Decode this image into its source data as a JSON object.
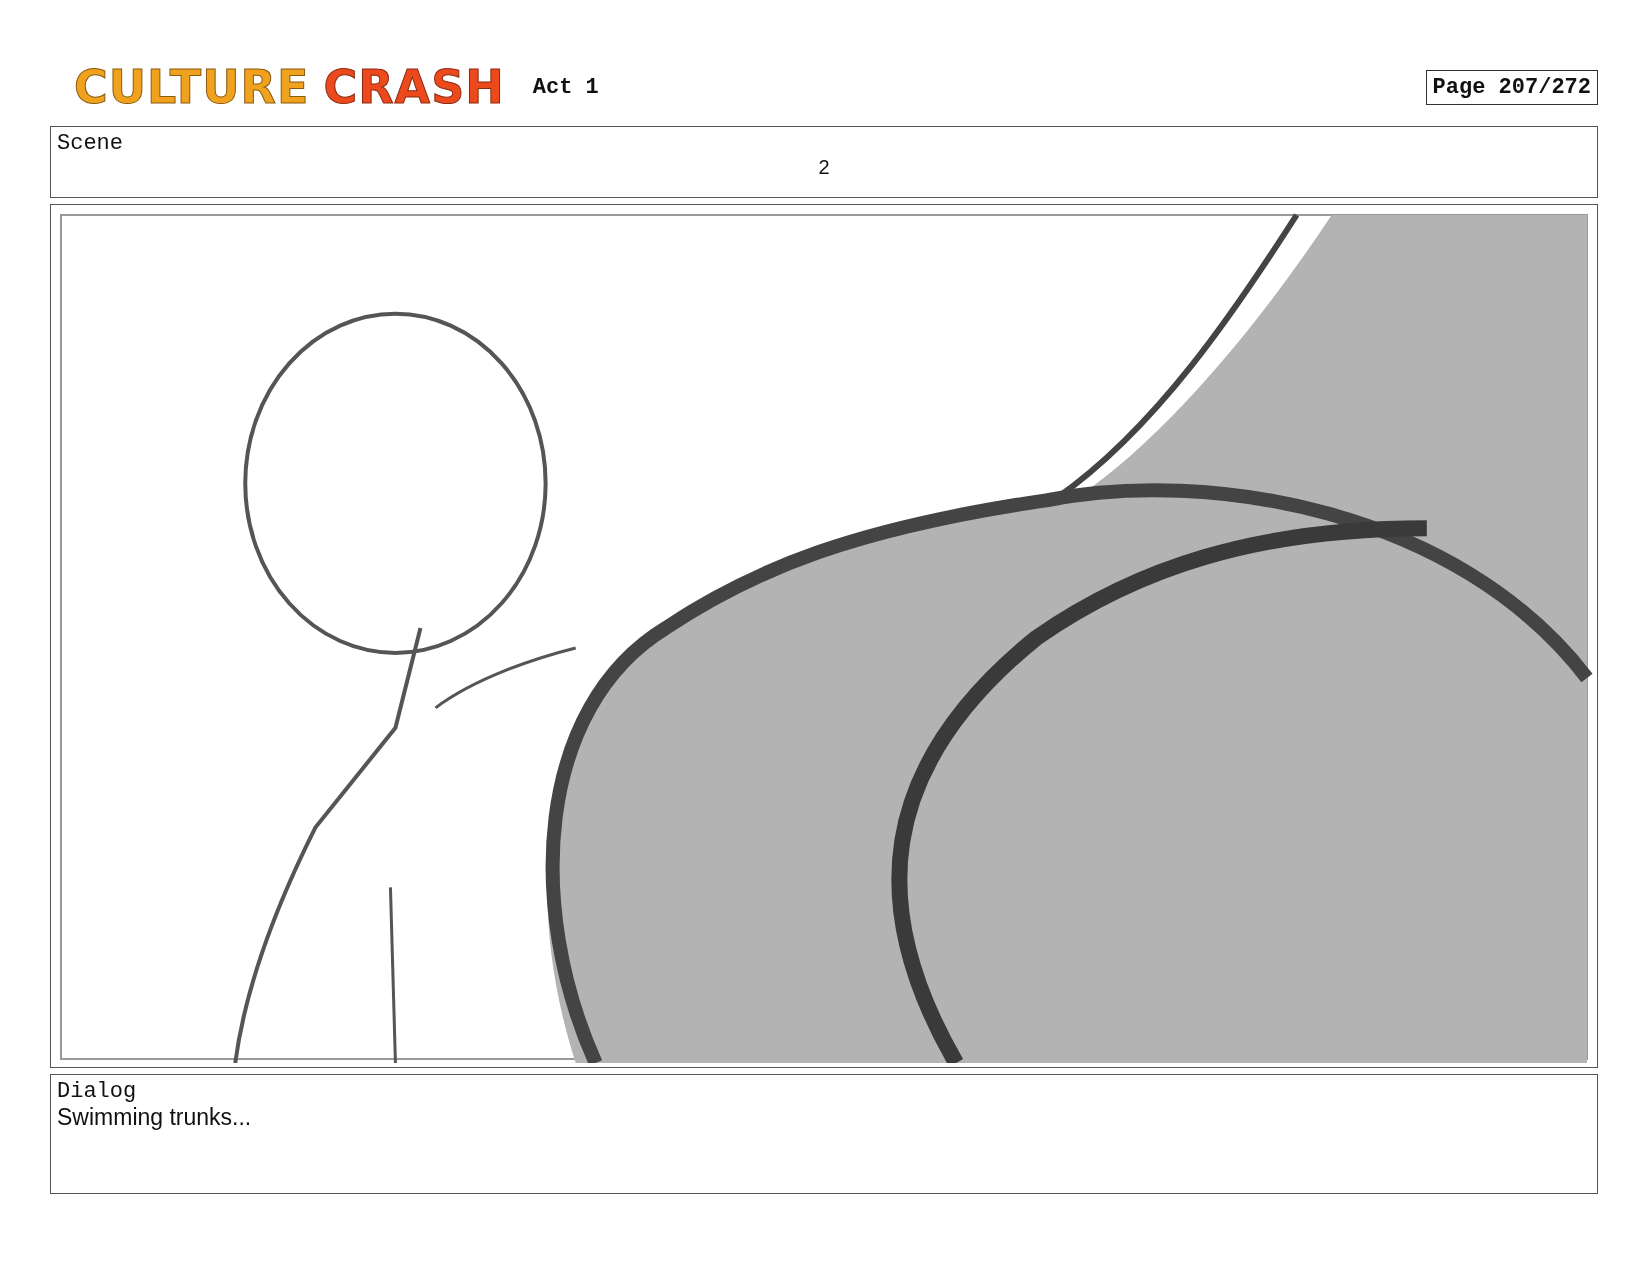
{
  "header": {
    "logo": [
      "CULTURE",
      "CRASH"
    ],
    "act": "Act 1",
    "page": "Page 207/272"
  },
  "scene": {
    "label": "Scene",
    "number": "2"
  },
  "dialog": {
    "label": "Dialog",
    "text": "Swimming trunks..."
  }
}
